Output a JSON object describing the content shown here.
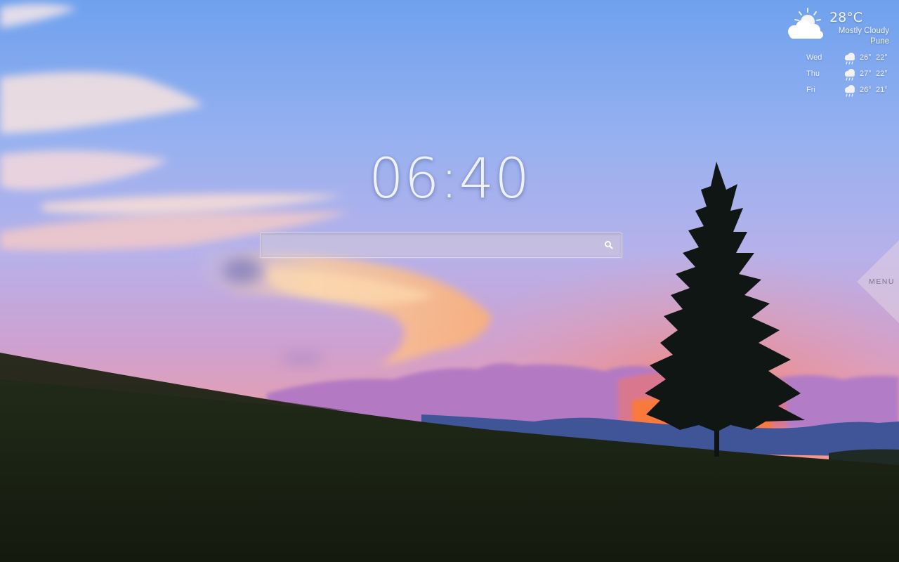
{
  "clock": {
    "time": "06:40"
  },
  "search": {
    "value": "",
    "placeholder": "",
    "icon": "search-icon"
  },
  "weather": {
    "current": {
      "temperature": "28°C",
      "condition": "Mostly Cloudy",
      "location": "Pune",
      "icon": "partly-cloudy-sun-icon"
    },
    "forecast": [
      {
        "day": "Wed",
        "high": "26°",
        "low": "22°",
        "icon": "rain-cloud-icon"
      },
      {
        "day": "Thu",
        "high": "27°",
        "low": "22°",
        "icon": "rain-cloud-icon"
      },
      {
        "day": "Fri",
        "high": "26°",
        "low": "21°",
        "icon": "rain-cloud-icon"
      }
    ]
  },
  "menu": {
    "label": "MENU"
  },
  "colors": {
    "sky_top": "#6fa3ee",
    "sky_mid": "#b7b2e8",
    "sky_low": "#d79ab8",
    "horizon_glow": "#ff8a4a",
    "ground": "#1b2414",
    "hills": "#3f5a9a"
  }
}
